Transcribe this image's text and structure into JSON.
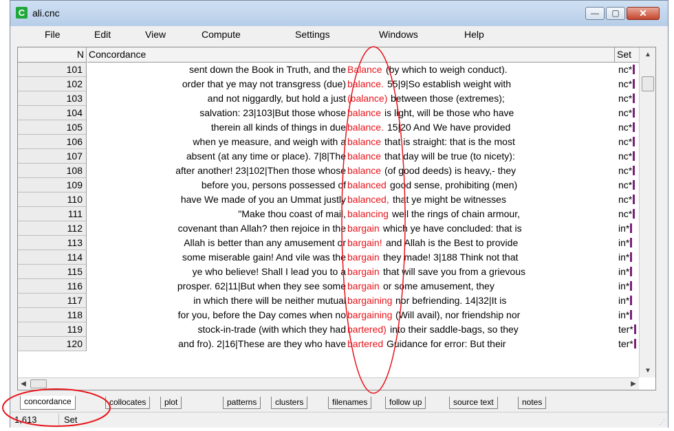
{
  "window": {
    "title": "ali.cnc",
    "app_icon_glyph": "C"
  },
  "controls": {
    "minimize": "—",
    "maximize": "▢",
    "close": "✕"
  },
  "menu": [
    "File",
    "Edit",
    "View",
    "Compute",
    "Settings",
    "Windows",
    "Help"
  ],
  "columns": {
    "n": "N",
    "concordance": "Concordance",
    "set": "Set"
  },
  "rows": [
    {
      "n": "101",
      "left": "sent down the Book in Truth, and the",
      "kw": "Balance",
      "right": "(by which to weigh conduct).",
      "set": "nc*"
    },
    {
      "n": "102",
      "left": "order that ye may not transgress (due)",
      "kw": "balance.",
      "right": "55|9|So establish weight with",
      "set": "nc*"
    },
    {
      "n": "103",
      "left": "and not niggardly, but hold a just",
      "kw": "(balance)",
      "right": "between those (extremes);",
      "set": "nc*"
    },
    {
      "n": "104",
      "left": "salvation: 23|103|But those whose",
      "kw": "balance",
      "right": "is light, will be those who have",
      "set": "nc*"
    },
    {
      "n": "105",
      "left": "therein all kinds of things in due",
      "kw": "balance.",
      "right": "15|20 And We have provided",
      "set": "nc*"
    },
    {
      "n": "106",
      "left": "when ye measure, and weigh with a",
      "kw": "balance",
      "right": "that is straight: that is the most",
      "set": "nc*"
    },
    {
      "n": "107",
      "left": "absent (at any time or place). 7|8|The",
      "kw": "balance",
      "right": "that day will be true (to nicety):",
      "set": "nc*"
    },
    {
      "n": "108",
      "left": "after another! 23|102|Then those whose",
      "kw": "balance",
      "right": "(of good deeds) is heavy,- they",
      "set": "nc*"
    },
    {
      "n": "109",
      "left": "before you, persons possessed of",
      "kw": "balanced",
      "right": "good sense, prohibiting (men)",
      "set": "nc*"
    },
    {
      "n": "110",
      "left": "have We made of you an Ummat justly",
      "kw": "balanced,",
      "right": "that ye might be witnesses",
      "set": "nc*"
    },
    {
      "n": "111",
      "left": "\"Make thou coast of mail,",
      "kw": "balancing",
      "right": "well the rings of chain armour,",
      "set": "nc*"
    },
    {
      "n": "112",
      "left": "covenant than Allah? then rejoice in the",
      "kw": "bargain",
      "right": "which ye have concluded: that is",
      "set": "in*"
    },
    {
      "n": "113",
      "left": "Allah is better than any amusement or",
      "kw": "bargain!",
      "right": "and Allah is the Best to provide",
      "set": "in*"
    },
    {
      "n": "114",
      "left": "some miserable gain! And vile was the",
      "kw": "bargain",
      "right": "they made! 3|188 Think not that",
      "set": "in*"
    },
    {
      "n": "115",
      "left": "ye who believe! Shall I lead you to a",
      "kw": "bargain",
      "right": "that will save you from a grievous",
      "set": "in*"
    },
    {
      "n": "116",
      "left": "prosper. 62|11|But when they see some",
      "kw": "bargain",
      "right": "or some amusement, they",
      "set": "in*"
    },
    {
      "n": "117",
      "left": "in which there will be neither mutual",
      "kw": "bargaining",
      "right": "nor befriending. 14|32|It is",
      "set": "in*"
    },
    {
      "n": "118",
      "left": "for you, before the Day comes when no",
      "kw": "bargaining",
      "right": "(Will avail), nor friendship nor",
      "set": "in*"
    },
    {
      "n": "119",
      "left": "stock-in-trade (with which they had",
      "kw": "bartered)",
      "right": "into their saddle-bags, so they",
      "set": "ter*"
    },
    {
      "n": "120",
      "left": "and fro). 2|16|These are they who have",
      "kw": "bartered",
      "right": "Guidance for error: But their",
      "set": "ter*"
    }
  ],
  "tabs": [
    "concordance",
    "collocates",
    "plot",
    "patterns",
    "clusters",
    "filenames",
    "follow up",
    "source text",
    "notes"
  ],
  "status": {
    "count": "1,613",
    "set_label": "Set"
  },
  "colors": {
    "keyword": "#e8131a",
    "annotation": "#e8131a",
    "set_bar": "#7a1f7a"
  }
}
